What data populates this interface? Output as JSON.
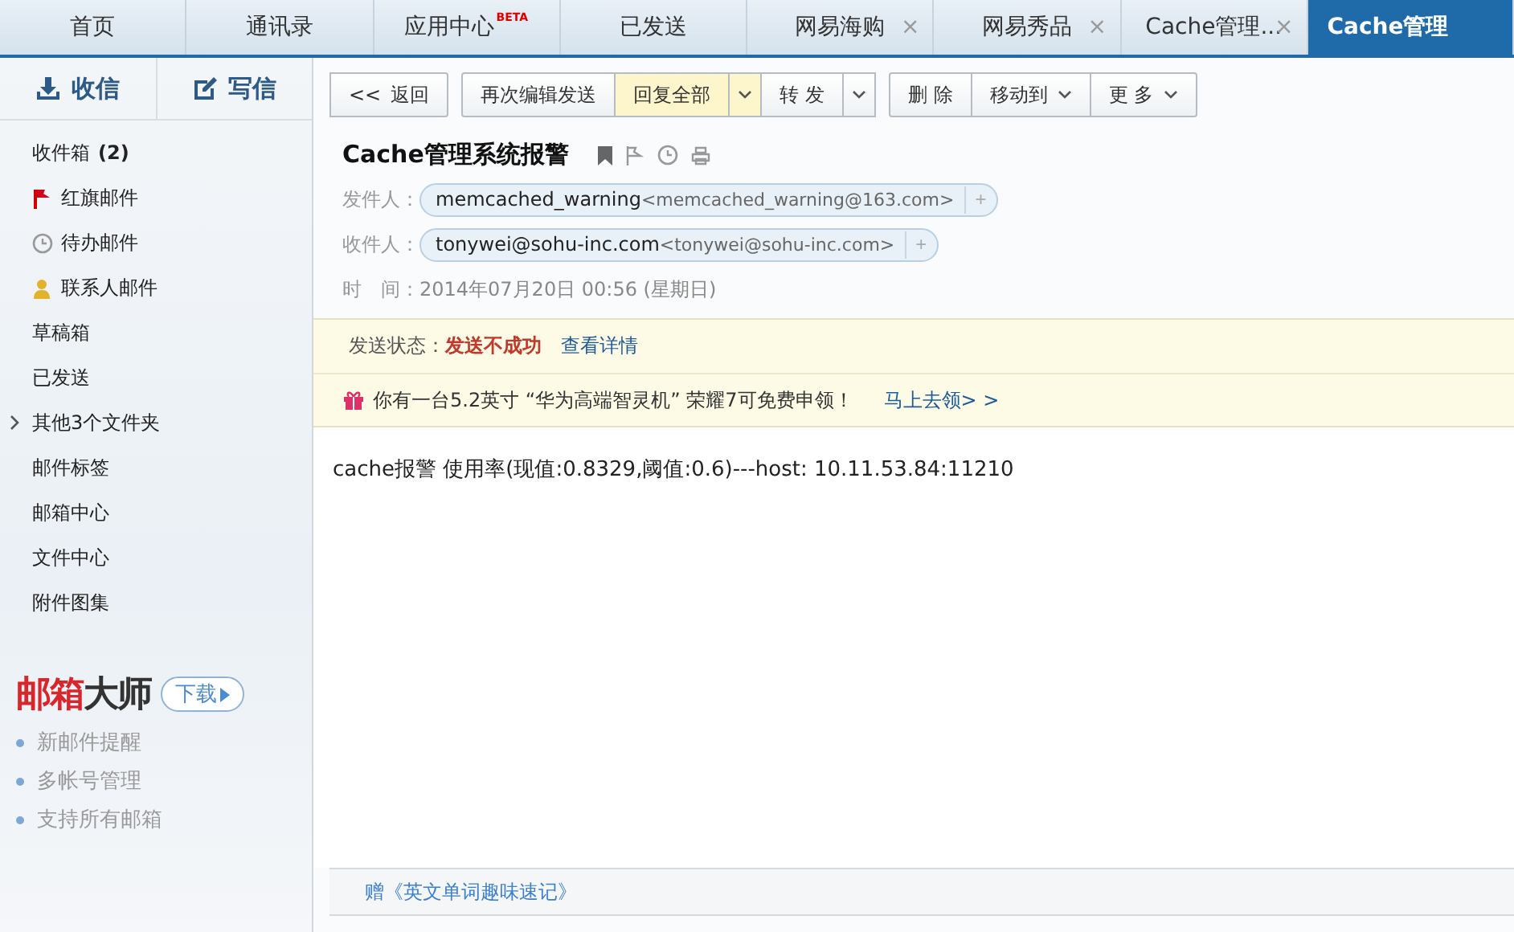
{
  "tabs": [
    {
      "label": "首页",
      "selected": false
    },
    {
      "label": "通讯录",
      "selected": false
    },
    {
      "label": "应用中心",
      "badge": "BETA",
      "selected": false
    },
    {
      "label": "已发送",
      "selected": false
    },
    {
      "label": "网易海购",
      "close": "×",
      "selected": false
    },
    {
      "label": "网易秀品",
      "close": "×",
      "selected": false
    },
    {
      "label": "Cache管理...",
      "close": "×",
      "selected": false
    },
    {
      "label": "Cache管理",
      "selected": true
    }
  ],
  "sidebar": {
    "receive": "收信",
    "compose": "写信",
    "items": [
      {
        "kind": "plain",
        "label": "收件箱",
        "count": "(2)"
      },
      {
        "kind": "flag",
        "label": "红旗邮件"
      },
      {
        "kind": "clock",
        "label": "待办邮件"
      },
      {
        "kind": "contact",
        "label": "联系人邮件"
      },
      {
        "kind": "plain",
        "label": "草稿箱"
      },
      {
        "kind": "plain",
        "label": "已发送"
      },
      {
        "kind": "group",
        "label": "其他3个文件夹",
        "expanded": false
      },
      {
        "kind": "plain",
        "label": "邮件标签"
      },
      {
        "kind": "plain",
        "label": "邮箱中心"
      },
      {
        "kind": "plain",
        "label": "文件中心"
      },
      {
        "kind": "plain",
        "label": "附件图集"
      }
    ],
    "promo": {
      "brand_red": "邮箱",
      "brand_dark": "大师",
      "download": "下载",
      "features": [
        "新邮件提醒",
        "多帐号管理",
        "支持所有邮箱"
      ]
    }
  },
  "toolbar": [
    [
      {
        "kind": "back",
        "label": "返回",
        "icon_text": "<<",
        "highlighted": false
      }
    ],
    [
      {
        "kind": "plain",
        "label": "再次编辑发送",
        "highlighted": false
      },
      {
        "kind": "split",
        "label": "回复全部",
        "highlighted": true
      },
      {
        "kind": "split",
        "label": "转 发",
        "highlighted": false
      }
    ],
    [
      {
        "kind": "plain",
        "label": "删 除",
        "highlighted": false
      },
      {
        "kind": "menu",
        "label": "移动到",
        "highlighted": false
      },
      {
        "kind": "menu",
        "label": "更 多",
        "highlighted": false
      }
    ]
  ],
  "message": {
    "subject": "Cache管理系统报警",
    "from": {
      "label": "发件人：",
      "name": "memcached_warning",
      "address": "<memcached_warning@163.com>",
      "add": "+"
    },
    "to": {
      "label": "收件人：",
      "name": "tonywei@sohu-inc.com",
      "address": "<tonywei@sohu-inc.com>",
      "add": "+"
    },
    "time": {
      "label": "时　间：",
      "value": "2014年07月20日 00:56 (星期日)"
    },
    "status": {
      "label": "发送状态：",
      "value": "发送不成功",
      "link": "查看详情"
    },
    "ad": {
      "text": "你有一台5.2英寸 “华为高端智灵机” 荣耀7可免费申领！",
      "link": "马上去领> >"
    },
    "body": "cache报警 使用率(现值:0.8329,阈值:0.6)---host: 10.11.53.84:11210",
    "footer_link": "赠《英文单词趣味速记》"
  }
}
